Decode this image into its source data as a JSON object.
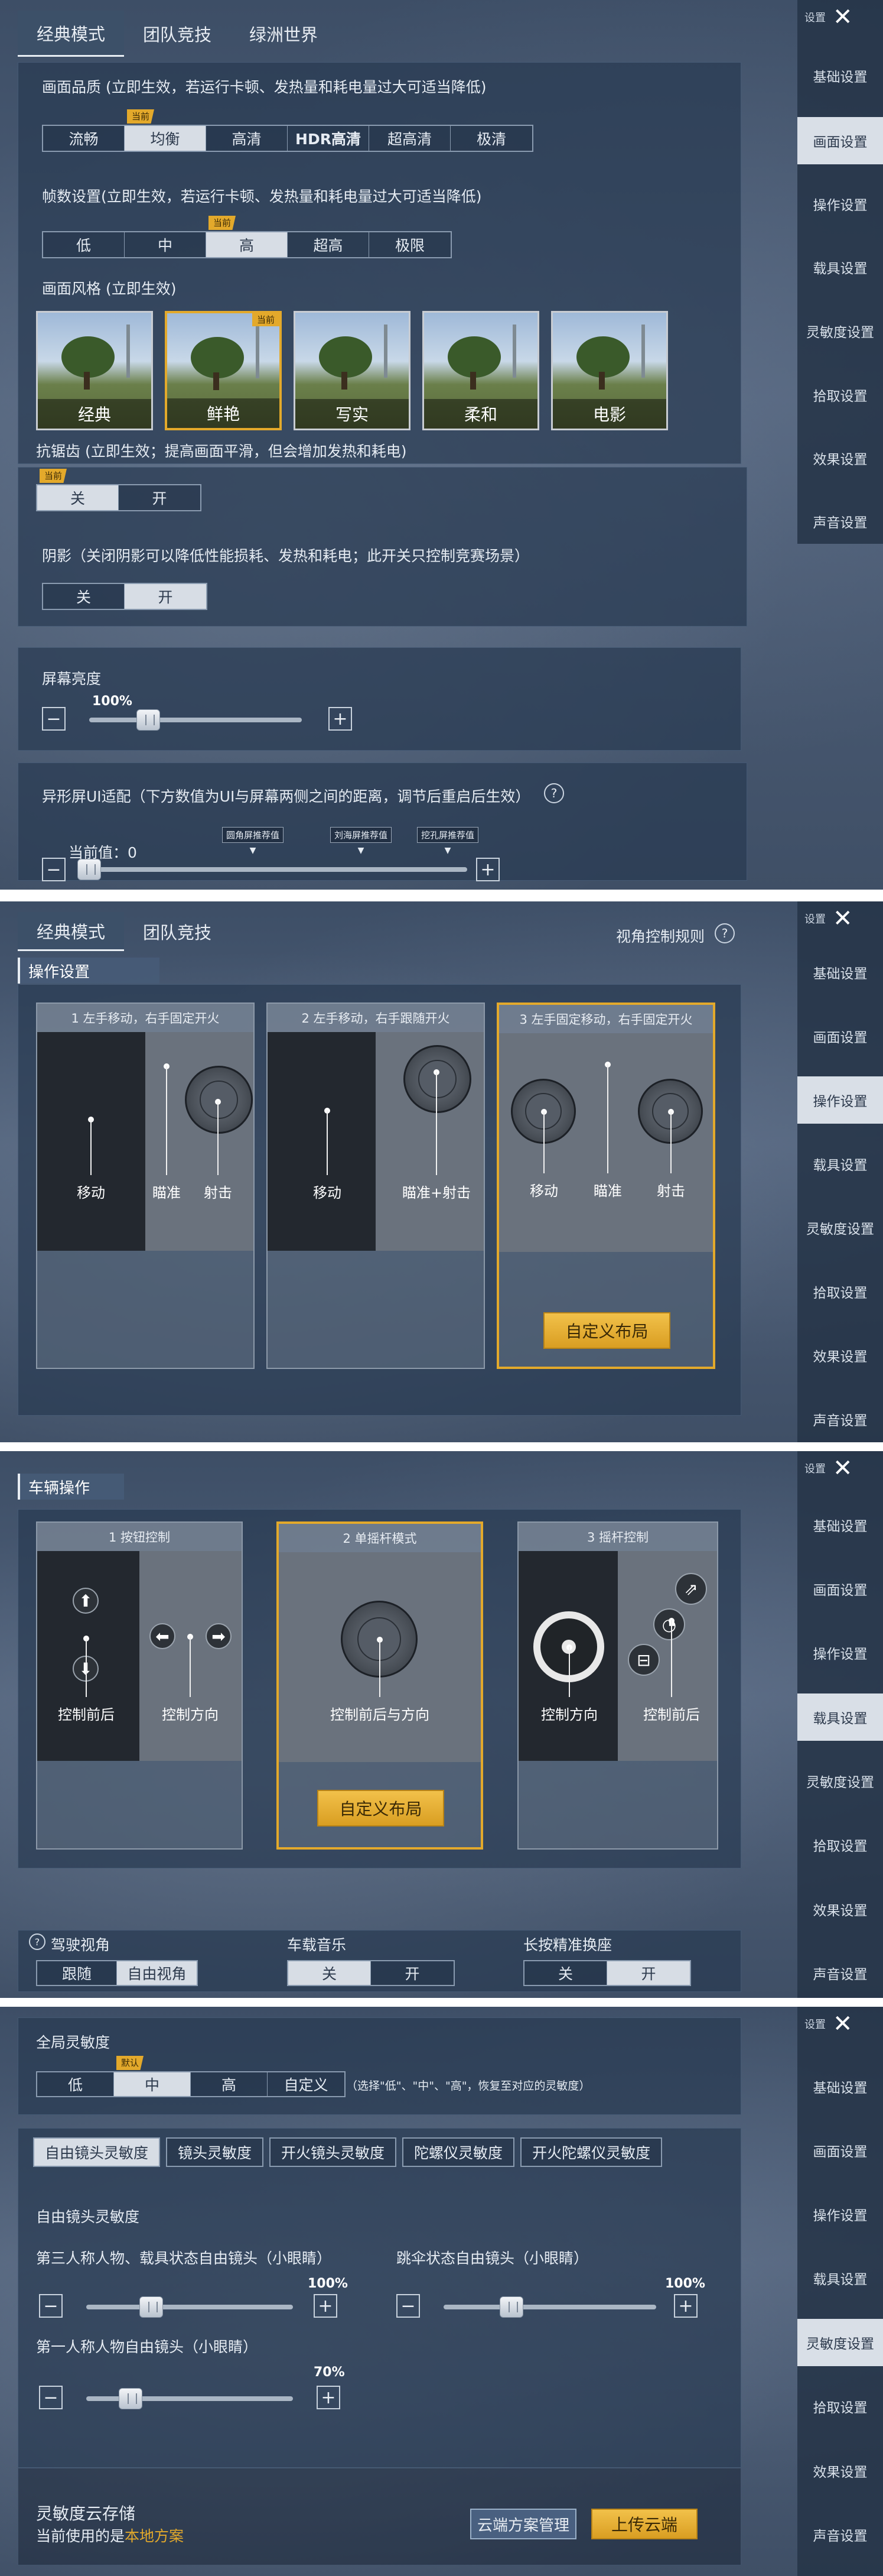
{
  "sidebar": {
    "title": "设置",
    "items": [
      "基础设置",
      "画面设置",
      "操作设置",
      "载具设置",
      "灵敏度设置",
      "拾取设置",
      "效果设置",
      "声音设置"
    ]
  },
  "s1": {
    "tabs": [
      "经典模式",
      "团队竞技",
      "绿洲世界"
    ],
    "quality_label": "画面品质 (立即生效，若运行卡顿、发热量和耗电量过大可适当降低)",
    "quality_options": [
      "流畅",
      "均衡",
      "高清",
      "HDR高清",
      "超高清",
      "极清"
    ],
    "current_badge": "当前",
    "fps_label": "帧数设置(立即生效，若运行卡顿、发热量和耗电量过大可适当降低)",
    "fps_options": [
      "低",
      "中",
      "高",
      "超高",
      "极限"
    ],
    "style_label": "画面风格 (立即生效)",
    "styles": [
      "经典",
      "鲜艳",
      "写实",
      "柔和",
      "电影"
    ],
    "aa_label": "抗锯齿 (立即生效；提高画面平滑，但会增加发热和耗电)",
    "onoff": [
      "关",
      "开"
    ],
    "shadow_label": "阴影（关闭阴影可以降低性能损耗、发热和耗电；此开关只控制竞赛场景）",
    "brightness_label": "屏幕亮度",
    "brightness_value": "100%",
    "notch_label": "异形屏UI适配（下方数值为UI与屏幕两侧之间的距离，调节后重启后生效）",
    "help": "?",
    "notch_current": "当前值：0",
    "notch_marks": [
      "圆角屏推荐值",
      "刘海屏推荐值",
      "挖孔屏推荐值"
    ]
  },
  "s2": {
    "tabs": [
      "经典模式",
      "团队竞技"
    ],
    "view_rule": "视角控制规则",
    "section": "操作设置",
    "cards": [
      {
        "title": "1  左手移动，右手固定开火",
        "labels": [
          "移动",
          "瞄准",
          "射击"
        ]
      },
      {
        "title": "2  左手移动，右手跟随开火",
        "labels": [
          "移动",
          "瞄准+射击"
        ]
      },
      {
        "title": "3  左手固定移动，右手固定开火",
        "labels": [
          "移动",
          "瞄准",
          "射击"
        ]
      }
    ],
    "custom_layout": "自定义布局"
  },
  "s3": {
    "section": "车辆操作",
    "cards": [
      {
        "title": "1  按钮控制",
        "labels": [
          "控制前后",
          "控制方向"
        ]
      },
      {
        "title": "2  单摇杆模式",
        "labels": [
          "控制前后与方向"
        ]
      },
      {
        "title": "3  摇杆控制",
        "labels": [
          "控制方向",
          "控制前后"
        ]
      }
    ],
    "custom_layout": "自定义布局",
    "driver_view_label": "驾驶视角",
    "driver_view_options": [
      "跟随",
      "自由视角"
    ],
    "music_label": "车载音乐",
    "seat_label": "长按精准换座",
    "onoff": [
      "关",
      "开"
    ],
    "help": "?"
  },
  "s4": {
    "global_label": "全局灵敏度",
    "global_options": [
      "低",
      "中",
      "高",
      "自定义"
    ],
    "default_badge": "默认",
    "global_hint": "（选择\"低\"、\"中\"、\"高\"，恢复至对应的灵敏度）",
    "sens_tabs": [
      "自由镜头灵敏度",
      "镜头灵敏度",
      "开火镜头灵敏度",
      "陀螺仪灵敏度",
      "开火陀螺仪灵敏度"
    ],
    "free_label": "自由镜头灵敏度",
    "tp_label": "第三人称人物、载具状态自由镜头（小眼睛）",
    "tp_value": "100%",
    "para_label": "跳伞状态自由镜头（小眼睛）",
    "para_value": "100%",
    "fp_label": "第一人称人物自由镜头（小眼睛）",
    "fp_value": "70%",
    "cloud_title": "灵敏度云存储",
    "cloud_using_prefix": "当前使用的是",
    "cloud_using_value": "本地方案",
    "cloud_manage": "云端方案管理",
    "cloud_upload": "上传云端"
  },
  "colors": {
    "accent": "#e3a92b",
    "link": "#e3a92b"
  }
}
